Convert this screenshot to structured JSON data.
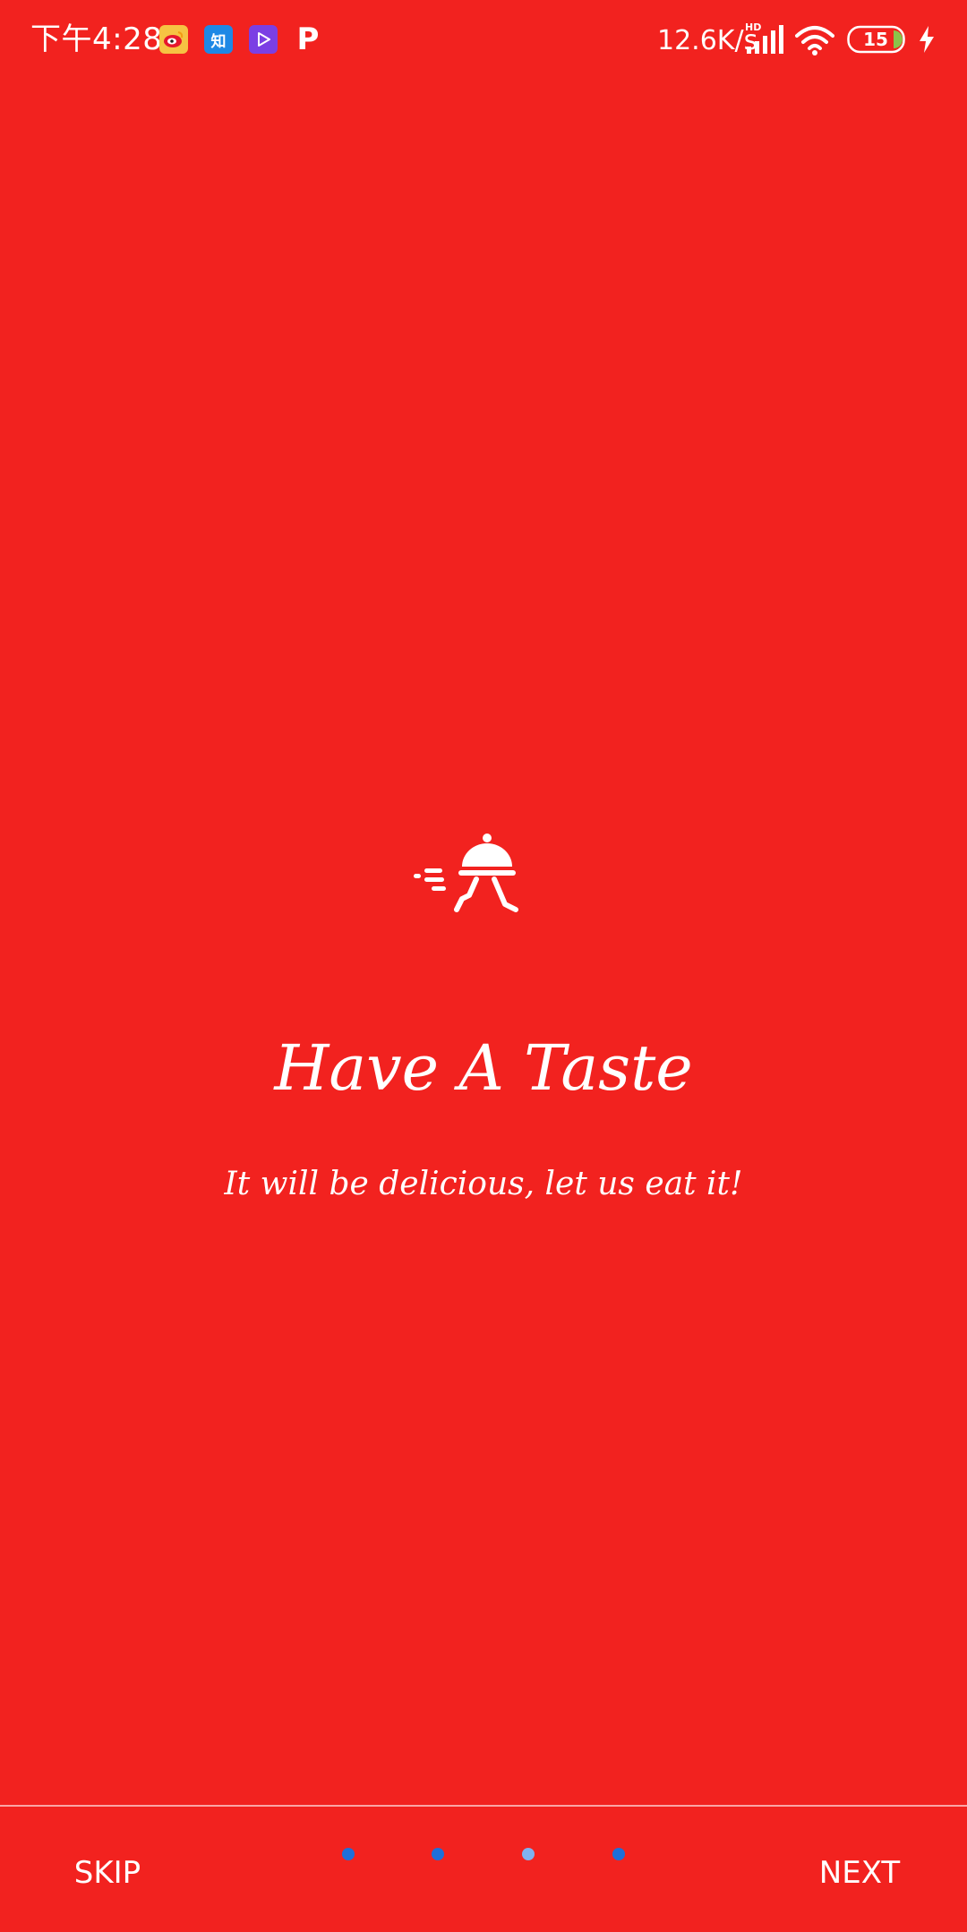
{
  "status_bar": {
    "time": "下午4:28",
    "network_speed": "12.6K/s",
    "battery_level": "15",
    "app_icons": [
      "weibo-icon",
      "zhihu-icon",
      "video-app-icon",
      "p-app-icon"
    ],
    "zhihu_label": "知",
    "p_label": "P"
  },
  "onboarding": {
    "title": "Have A Taste",
    "subtitle": "It will be delicious, let us eat it!",
    "logo_icon": "food-delivery-icon"
  },
  "bottom_nav": {
    "skip_label": "SKIP",
    "next_label": "NEXT",
    "page_count": 4,
    "active_page_index": 2
  },
  "colors": {
    "background": "#f2221f",
    "dot_inactive": "#1e6fd9",
    "dot_active": "#7fb2f0",
    "text": "#ffffff"
  }
}
